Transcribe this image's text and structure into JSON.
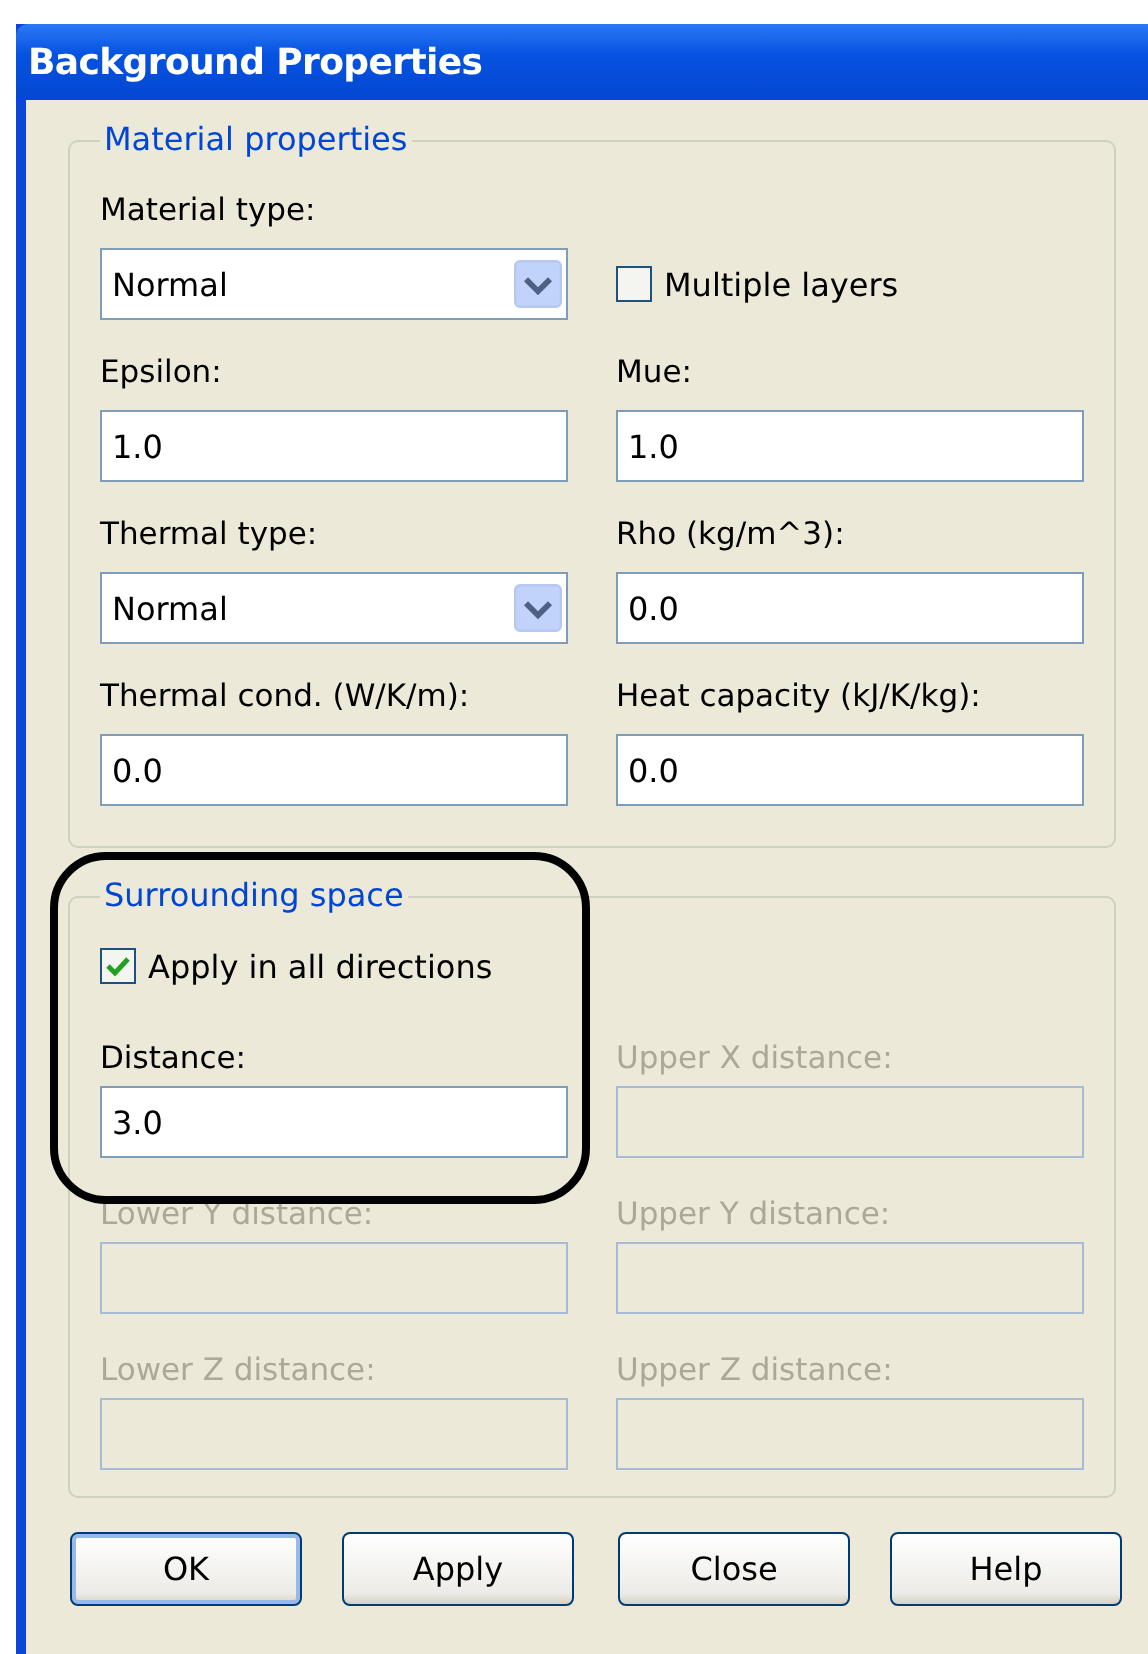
{
  "window": {
    "title": "Background Properties"
  },
  "material_properties": {
    "legend": "Material properties",
    "fields": [
      {
        "kind": "combo",
        "label": "Material type:",
        "value": "Normal"
      },
      {
        "kind": "checkbox",
        "label": "Multiple layers",
        "checked": false
      },
      {
        "kind": "text",
        "label": "Epsilon:",
        "value": "1.0"
      },
      {
        "kind": "text",
        "label": "Mue:",
        "value": "1.0"
      },
      {
        "kind": "combo",
        "label": "Thermal type:",
        "value": "Normal"
      },
      {
        "kind": "text",
        "label": "Rho (kg/m^3):",
        "value": "0.0"
      },
      {
        "kind": "text",
        "label": "Thermal cond. (W/K/m):",
        "value": "0.0"
      },
      {
        "kind": "text",
        "label": "Heat capacity (kJ/K/kg):",
        "value": "0.0"
      }
    ]
  },
  "surrounding_space": {
    "legend": "Surrounding space",
    "apply_all": {
      "label": "Apply in all directions",
      "checked": true
    },
    "fields": [
      {
        "label": "Distance:",
        "value": "3.0",
        "disabled": false
      },
      {
        "label": "Upper X distance:",
        "disabled": true
      },
      {
        "label": "Lower Y distance:",
        "disabled": true
      },
      {
        "label": "Upper Y distance:",
        "disabled": true
      },
      {
        "label": "Lower Z distance:",
        "disabled": true
      },
      {
        "label": "Upper Z distance:",
        "disabled": true
      }
    ]
  },
  "annotation": {
    "kind": "rounded-outline"
  },
  "buttons": [
    {
      "label": "OK",
      "default": true
    },
    {
      "label": "Apply",
      "default": false
    },
    {
      "label": "Close",
      "default": false
    },
    {
      "label": "Help",
      "default": false
    }
  ]
}
